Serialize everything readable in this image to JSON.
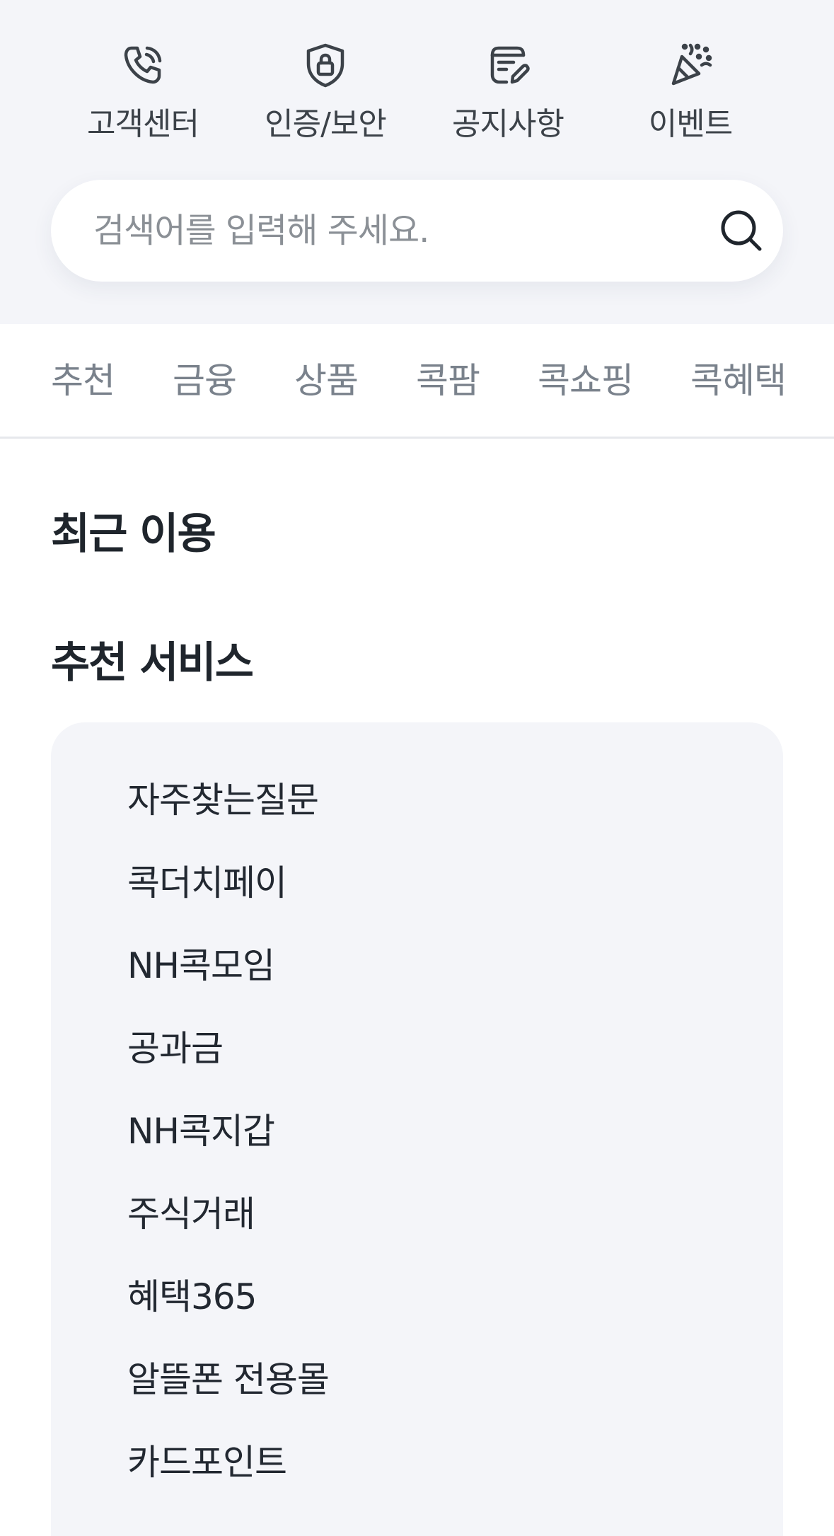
{
  "quick_menu": [
    {
      "label": "고객센터",
      "icon": "phone-icon"
    },
    {
      "label": "인증/보안",
      "icon": "shield-lock-icon"
    },
    {
      "label": "공지사항",
      "icon": "notice-edit-icon"
    },
    {
      "label": "이벤트",
      "icon": "party-popper-icon"
    }
  ],
  "search": {
    "placeholder": "검색어를 입력해 주세요.",
    "value": "",
    "icon": "search-icon"
  },
  "tabs": [
    {
      "label": "추천"
    },
    {
      "label": "금융"
    },
    {
      "label": "상품"
    },
    {
      "label": "콕팜"
    },
    {
      "label": "콕쇼핑"
    },
    {
      "label": "콕혜택"
    }
  ],
  "recent": {
    "title": "최근 이용"
  },
  "recommend": {
    "title": "추천 서비스",
    "items": [
      {
        "label": "자주찾는질문"
      },
      {
        "label": "콕더치페이"
      },
      {
        "label": "NH콕모임"
      },
      {
        "label": "공과금"
      },
      {
        "label": "NH콕지갑"
      },
      {
        "label": "주식거래"
      },
      {
        "label": "혜택365"
      },
      {
        "label": "알뜰폰 전용몰"
      },
      {
        "label": "카드포인트"
      }
    ]
  },
  "colors": {
    "top_background": "#f4f5f9",
    "service_box_background": "#f4f5f9",
    "text_primary": "#222831",
    "text_secondary": "#3c4249",
    "tab_inactive": "#7a828c",
    "placeholder": "#8b9096",
    "divider": "#e6e8ec"
  }
}
